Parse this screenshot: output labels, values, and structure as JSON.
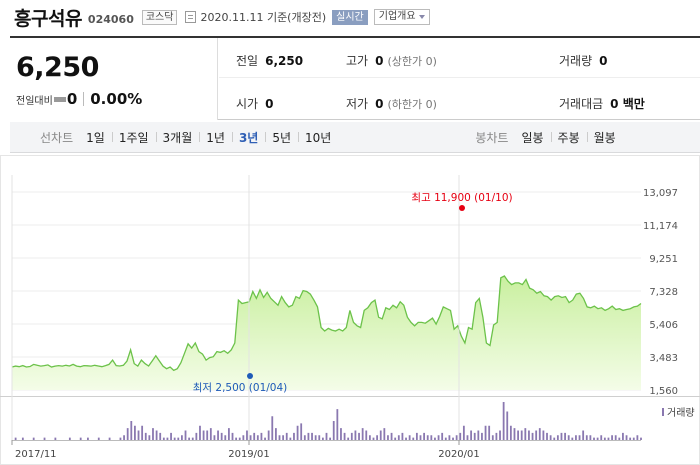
{
  "header": {
    "stock_name": "흥구석유",
    "stock_code": "024060",
    "market": "코스닥",
    "base_date": "2020.11.11 기준(개장전)",
    "realtime": "실시간",
    "company_info": "기업개요"
  },
  "summary": {
    "price": "6,250",
    "change_label": "전일대비",
    "change_value": "0",
    "change_rate": "0.00%",
    "prev_close_label": "전일",
    "prev_close": "6,250",
    "high_label": "고가",
    "high": "0",
    "high_limit": "(상한가 0)",
    "volume_label": "거래량",
    "volume": "0",
    "open_label": "시가",
    "open": "0",
    "low_label": "저가",
    "low": "0",
    "low_limit": "(하한가 0)",
    "amount_label": "거래대금",
    "amount": "0 백만"
  },
  "periods": {
    "line_label": "선차트",
    "line_items": [
      "1일",
      "1주일",
      "3개월",
      "1년",
      "3년",
      "5년",
      "10년"
    ],
    "active": "3년",
    "candle_label": "봉차트",
    "candle_items": [
      "일봉",
      "주봉",
      "월봉"
    ]
  },
  "colors": {
    "line": "#6cc24a",
    "fill_top": "#c9ef9f",
    "fill_bottom": "#f4fde8",
    "volume_bar": "#8a78b0",
    "high_marker": "#e60012",
    "low_marker": "#1e5bb8"
  },
  "chart_data": {
    "type": "area",
    "x_labels": [
      "2017/11",
      "2019/01",
      "2020/01"
    ],
    "yticks": [
      "13,097",
      "11,174",
      "9,251",
      "7,328",
      "5,406",
      "3,483",
      "1,560"
    ],
    "ylim": [
      1560,
      13097
    ],
    "high_annotation": "최고 11,900 (01/10)",
    "low_annotation": "최저 2,500 (01/04)",
    "volume_label": "거래량",
    "price_series": [
      2900,
      2950,
      2920,
      2980,
      2900,
      2930,
      3050,
      3000,
      2950,
      2980,
      3020,
      2900,
      2950,
      2980,
      2950,
      3000,
      2960,
      3050,
      2950,
      2920,
      2980,
      2970,
      2950,
      3000,
      2960,
      2920,
      2980,
      3050,
      3300,
      2980,
      2960,
      3000,
      3250,
      3900,
      3100,
      2950,
      3300,
      3100,
      2960,
      3250,
      3550,
      3250,
      2950,
      2800,
      2900,
      2700,
      2800,
      3150,
      3700,
      4250,
      4000,
      4300,
      3800,
      3650,
      3300,
      3450,
      3500,
      3800,
      3750,
      3850,
      3700,
      3900,
      4300,
      6800,
      6600,
      6650,
      6700,
      7300,
      6900,
      7400,
      6950,
      7250,
      6900,
      6700,
      6500,
      7000,
      6650,
      6400,
      6500,
      7000,
      6900,
      7350,
      7300,
      7150,
      6800,
      6400,
      5200,
      5000,
      5150,
      5050,
      5000,
      5100,
      5000,
      5200,
      6200,
      5500,
      5300,
      5200,
      6200,
      6350,
      6650,
      6800,
      5800,
      5700,
      6350,
      6250,
      6500,
      6350,
      6700,
      6500,
      5800,
      5500,
      5300,
      5500,
      5500,
      5450,
      5600,
      5750,
      5400,
      5850,
      6400,
      6300,
      6200,
      5100,
      5300,
      4700,
      4300,
      5200,
      5100,
      6650,
      6900,
      5800,
      4300,
      4150,
      5350,
      5500,
      8100,
      8200,
      7900,
      7700,
      7800,
      7800,
      7700,
      8000,
      7500,
      7400,
      7200,
      7300,
      7050,
      7000,
      6800,
      7000,
      7050,
      6950,
      7000,
      6650,
      6800,
      7150,
      7200,
      6900,
      6400,
      6350,
      6450,
      6300,
      6350,
      6200,
      6300,
      6450,
      6250,
      6300,
      6200,
      6250,
      6300,
      6400,
      6450,
      6600
    ],
    "volume_series": [
      0,
      1,
      0,
      1,
      0,
      0,
      1,
      0,
      0,
      1,
      0,
      0,
      1,
      0,
      0,
      0,
      1,
      0,
      0,
      1,
      0,
      1,
      0,
      0,
      1,
      0,
      0,
      1,
      0,
      0,
      1,
      2,
      5,
      8,
      6,
      4,
      6,
      3,
      2,
      5,
      4,
      3,
      1,
      1,
      3,
      1,
      1,
      2,
      4,
      1,
      1,
      3,
      6,
      4,
      4,
      5,
      2,
      4,
      3,
      2,
      5,
      3,
      1,
      1,
      2,
      4,
      2,
      3,
      2,
      3,
      1,
      4,
      10,
      5,
      2,
      2,
      3,
      1,
      3,
      6,
      7,
      2,
      3,
      3,
      2,
      2,
      1,
      3,
      1,
      8,
      13,
      5,
      3,
      1,
      3,
      4,
      3,
      5,
      4,
      2,
      1,
      2,
      4,
      5,
      2,
      3,
      1,
      2,
      3,
      1,
      2,
      1,
      3,
      2,
      3,
      2,
      2,
      1,
      2,
      3,
      1,
      2,
      1,
      2,
      3,
      6,
      2,
      4,
      3,
      4,
      3,
      6,
      6,
      2,
      3,
      4,
      16,
      12,
      6,
      5,
      4,
      4,
      5,
      4,
      3,
      4,
      5,
      4,
      3,
      2,
      1,
      2,
      3,
      3,
      2,
      1,
      2,
      2,
      4,
      2,
      2,
      1,
      1,
      2,
      1,
      1,
      2,
      2,
      1,
      3,
      2,
      1,
      1,
      2,
      1
    ]
  }
}
